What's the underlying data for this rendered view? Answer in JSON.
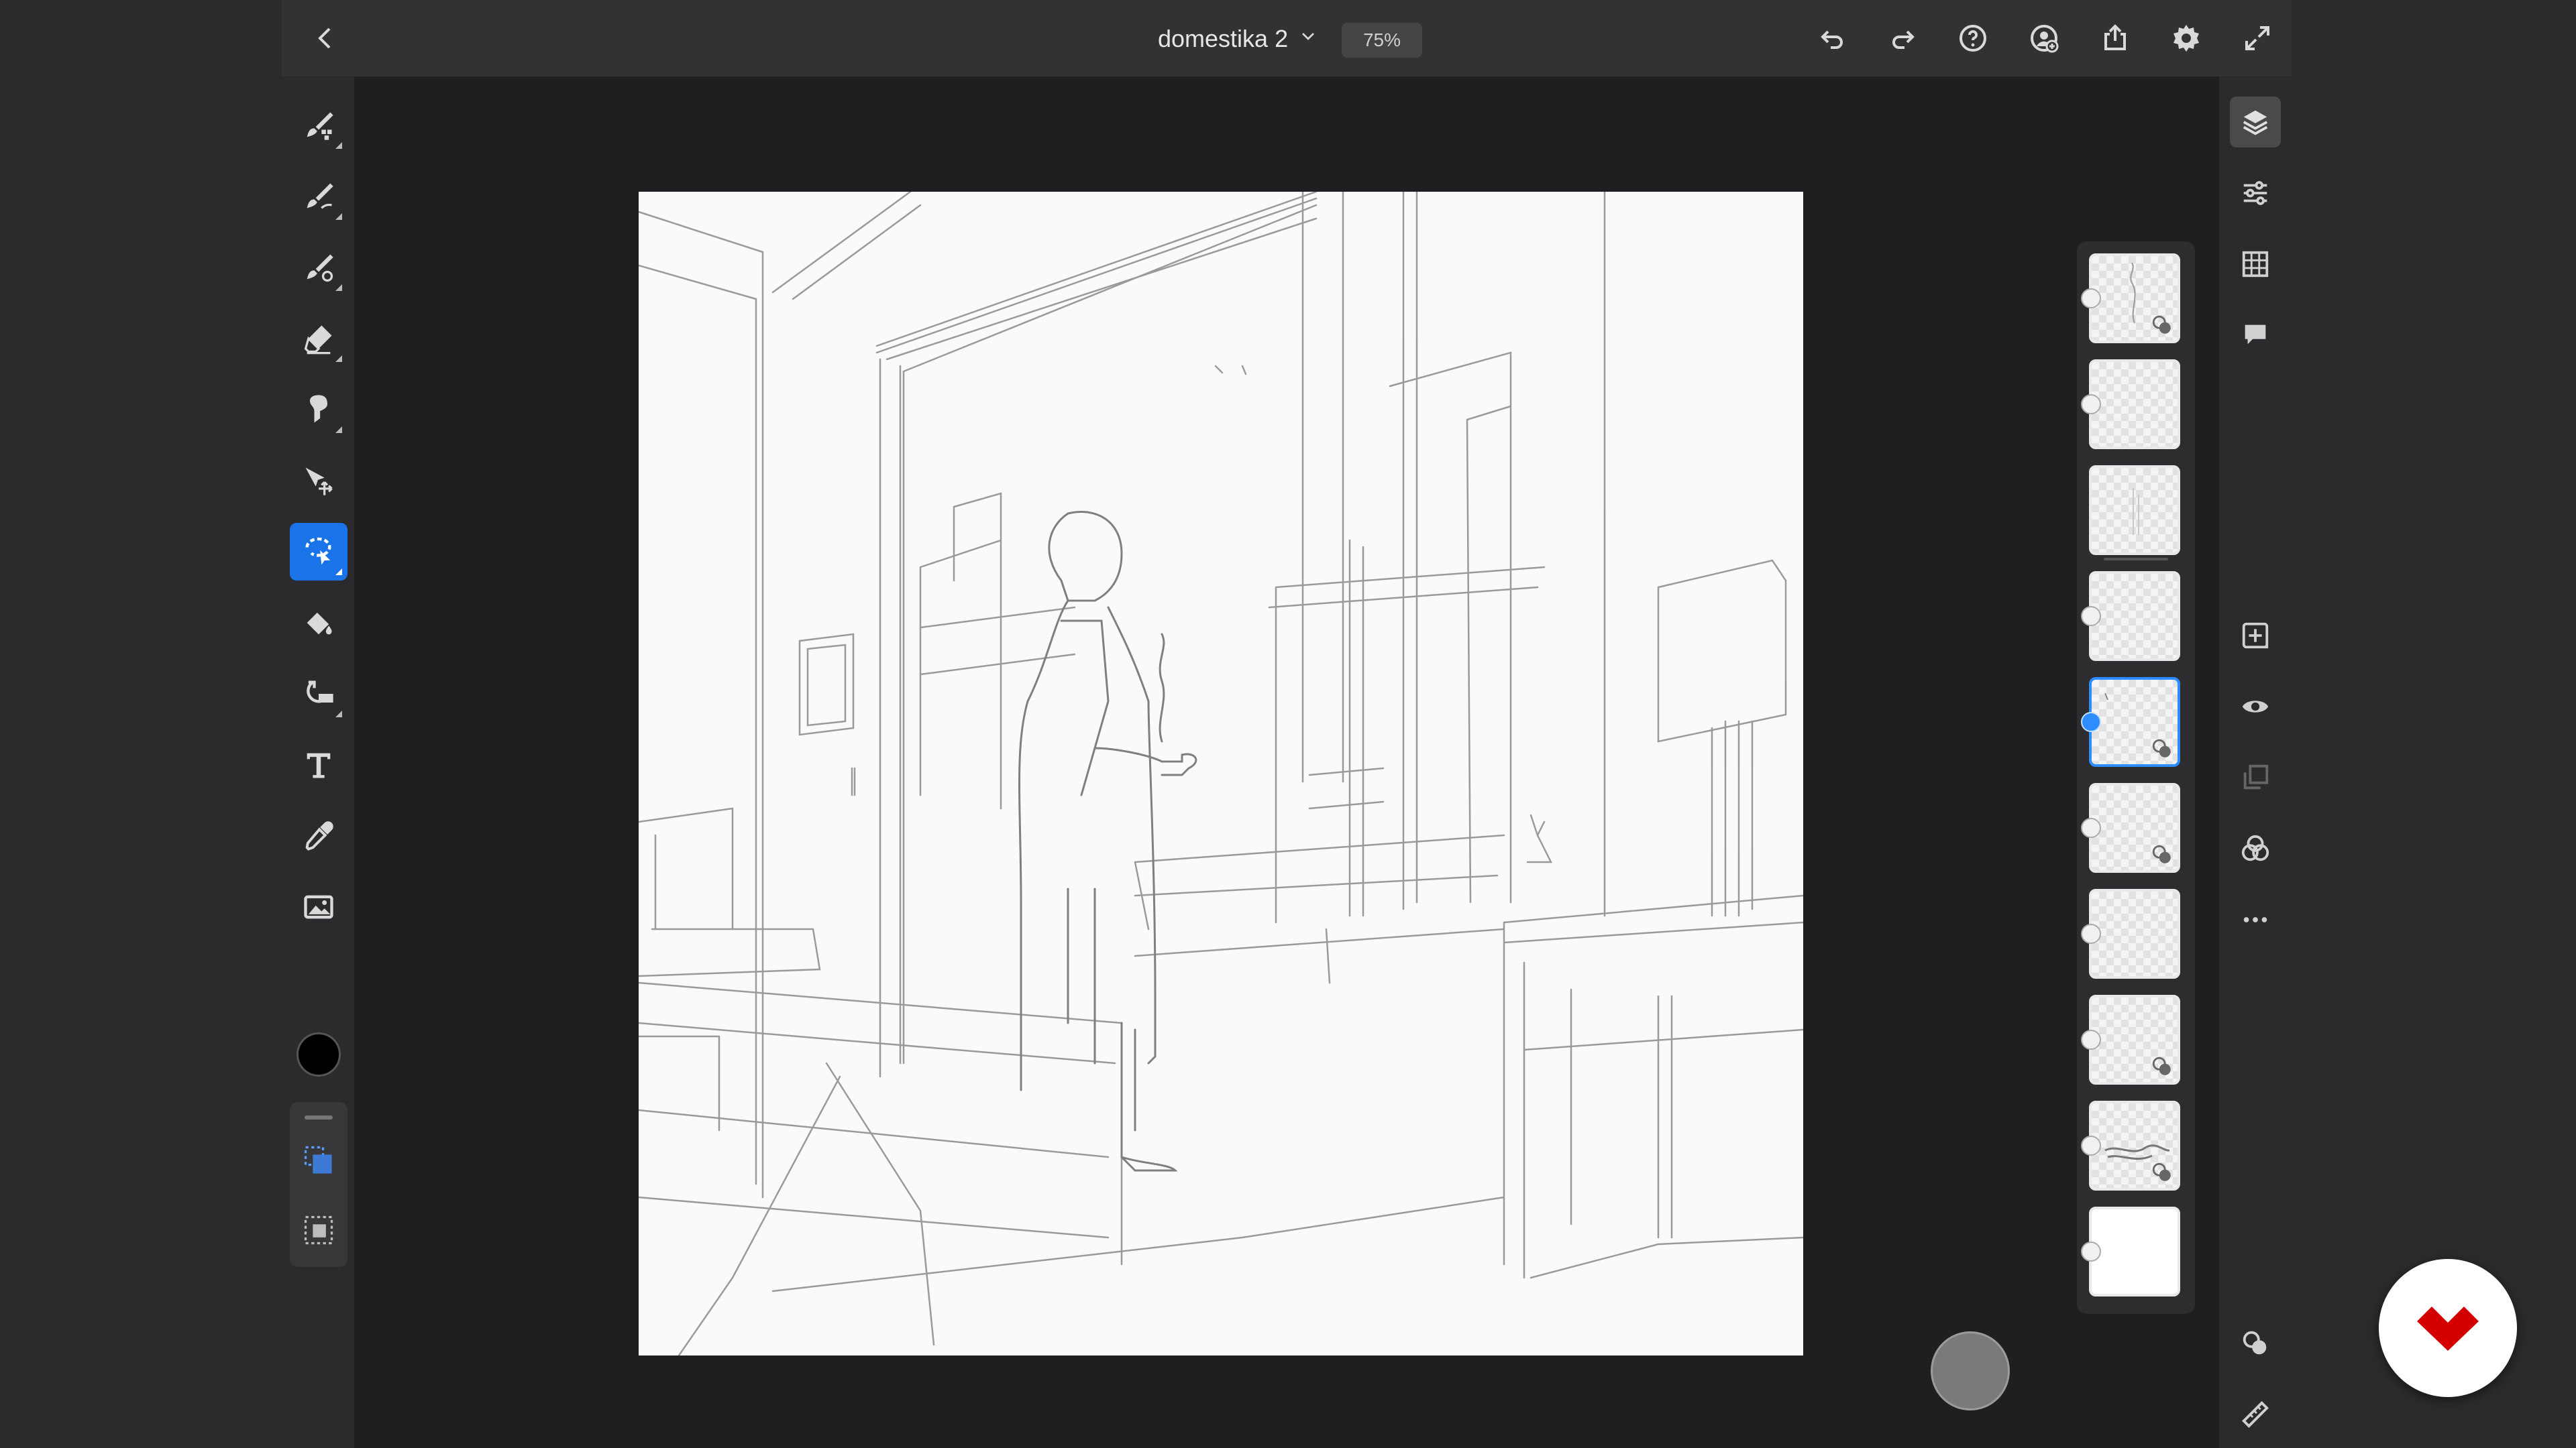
{
  "document": {
    "title": "domestika 2",
    "zoom": "75%"
  },
  "colors": {
    "accent": "#1a73e8",
    "selected_layer": "#2d8cff",
    "brush_color": "#000000",
    "brand": "#d40000"
  },
  "topbar_icons": [
    "back-icon",
    "chevron-down-icon",
    "undo-icon",
    "redo-icon",
    "help-icon",
    "invite-icon",
    "share-icon",
    "settings-icon",
    "fullscreen-icon"
  ],
  "tools": [
    {
      "icon": "pixel-brush-icon",
      "active": false
    },
    {
      "icon": "live-brush-icon",
      "active": false
    },
    {
      "icon": "vector-brush-icon",
      "active": false
    },
    {
      "icon": "eraser-icon",
      "active": false
    },
    {
      "icon": "smudge-icon",
      "active": false
    },
    {
      "icon": "move-transform-icon",
      "active": false
    },
    {
      "icon": "lasso-select-icon",
      "active": true
    },
    {
      "icon": "paint-bucket-icon",
      "active": false
    },
    {
      "icon": "shapes-icon",
      "active": false
    },
    {
      "icon": "text-icon",
      "active": false
    },
    {
      "icon": "eyedropper-icon",
      "active": false
    },
    {
      "icon": "place-image-icon",
      "active": false
    },
    {
      "icon": "color-swatch",
      "active": false
    },
    {
      "icon": "select-subject-icon",
      "active": false
    },
    {
      "icon": "invert-selection-icon",
      "active": false
    }
  ],
  "layers": [
    {
      "thumbnail": "steam-sketch",
      "has_mask": true,
      "active": false
    },
    {
      "thumbnail": "empty",
      "has_mask": false,
      "active": false
    },
    {
      "thumbnail": "faint-sketch",
      "has_mask": false,
      "active": false
    },
    {
      "thumbnail": "empty",
      "has_mask": false,
      "active": false
    },
    {
      "thumbnail": "sketch",
      "has_mask": true,
      "active": true
    },
    {
      "thumbnail": "empty",
      "has_mask": true,
      "active": false
    },
    {
      "thumbnail": "empty",
      "has_mask": false,
      "active": false
    },
    {
      "thumbnail": "empty",
      "has_mask": true,
      "active": false
    },
    {
      "thumbnail": "texture",
      "has_mask": true,
      "active": false
    },
    {
      "thumbnail": "background-white",
      "has_mask": false,
      "active": false
    }
  ],
  "right_panel_icons": [
    "layers-icon",
    "properties-icon",
    "grid-icon",
    "comments-icon",
    "add-layer-icon",
    "visibility-icon",
    "merge-down-icon",
    "blend-mode-icon",
    "more-icon",
    "layer-mask-icon",
    "ruler-icon"
  ],
  "brand_logo": "domestika-logo"
}
